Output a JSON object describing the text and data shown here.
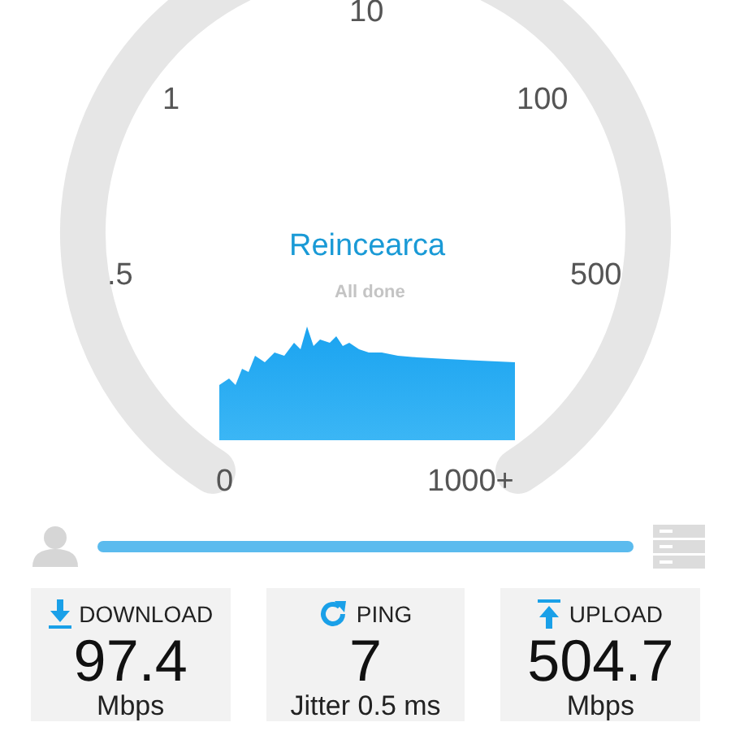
{
  "gauge": {
    "ticks": [
      "10",
      "1",
      "100",
      ".5",
      "500",
      "0",
      "1000+"
    ],
    "action": "Reincearca",
    "status": "All done"
  },
  "results": [
    {
      "kind": "download",
      "label": "DOWNLOAD",
      "value": "97.4",
      "unit": "Mbps"
    },
    {
      "kind": "ping",
      "label": "PING",
      "value": "7",
      "unit": "Jitter 0.5 ms"
    },
    {
      "kind": "upload",
      "label": "UPLOAD",
      "value": "504.7",
      "unit": "Mbps"
    }
  ]
}
